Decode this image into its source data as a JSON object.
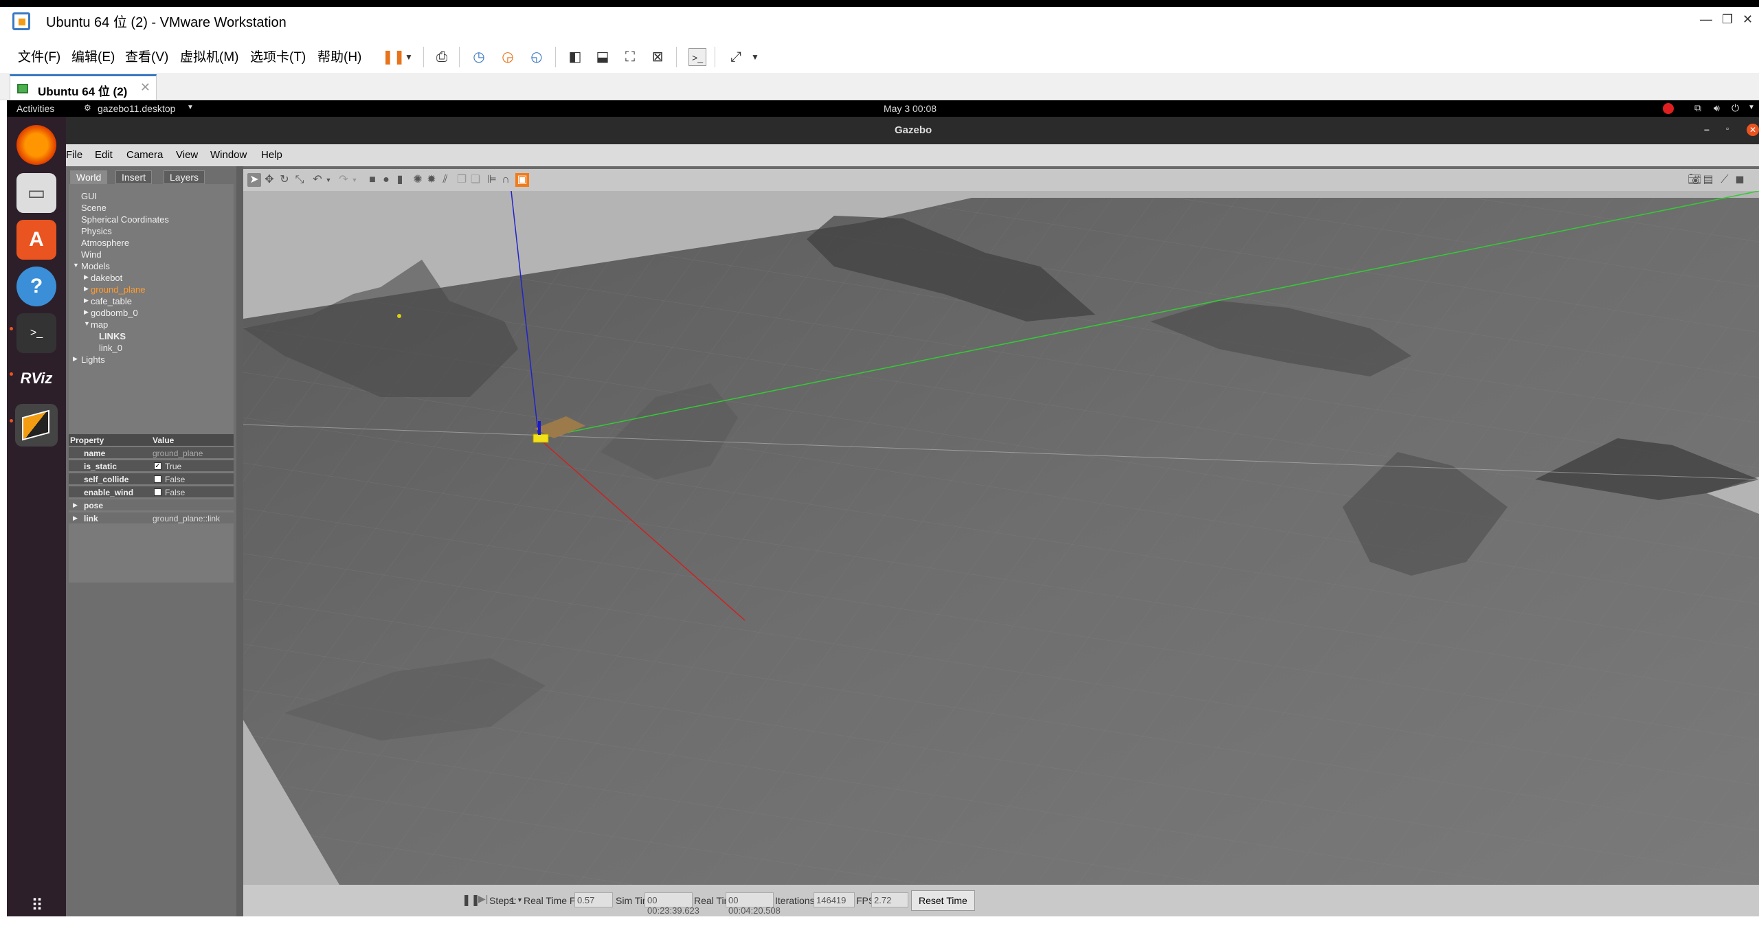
{
  "vmware": {
    "title": "Ubuntu 64 位 (2) - VMware Workstation",
    "menu": [
      "文件(F)",
      "编辑(E)",
      "查看(V)",
      "虚拟机(M)",
      "选项卡(T)",
      "帮助(H)"
    ],
    "tab_label": "Ubuntu 64 位 (2)"
  },
  "ubuntu": {
    "activities": "Activities",
    "app_menu": "gazebo11.desktop",
    "clock": "May 3  00:08",
    "dock": [
      "firefox-icon",
      "files-icon",
      "app-store-icon",
      "help-icon",
      "terminal-icon",
      "rviz-icon",
      "gazebo-icon"
    ],
    "rviz_label": "RViz"
  },
  "gazebo": {
    "window_title": "Gazebo",
    "menu": [
      "File",
      "Edit",
      "Camera",
      "View",
      "Window",
      "Help"
    ],
    "tabs": [
      "World",
      "Insert",
      "Layers"
    ],
    "tree": {
      "top": [
        "GUI",
        "Scene",
        "Spherical Coordinates",
        "Physics",
        "Atmosphere",
        "Wind"
      ],
      "models_label": "Models",
      "models": [
        "dakebot",
        "ground_plane",
        "cafe_table",
        "godbomb_0",
        "map"
      ],
      "selected_model": "ground_plane",
      "map_children": [
        "LINKS",
        "link_0"
      ],
      "lights_label": "Lights"
    },
    "properties": {
      "header_property": "Property",
      "header_value": "Value",
      "rows": [
        {
          "key": "name",
          "value": "ground_plane"
        },
        {
          "key": "is_static",
          "value": "True"
        },
        {
          "key": "self_collide",
          "value": "False"
        },
        {
          "key": "enable_wind",
          "value": "False"
        },
        {
          "key": "pose",
          "value": ""
        },
        {
          "key": "link",
          "value": "ground_plane::link"
        }
      ]
    },
    "bottom": {
      "steps_label": "Steps:",
      "steps_value": "1",
      "rtf_label": "Real Time Factor:",
      "rtf_value": "0.57",
      "sim_time_label": "Sim Time:",
      "sim_time_value": "00 00:23:39.623",
      "real_time_label": "Real Time:",
      "real_time_value": "00 00:04:20.508",
      "iterations_label": "Iterations:",
      "iterations_value": "146419",
      "fps_label": "FPS:",
      "fps_value": "2.72",
      "reset_label": "Reset Time"
    }
  },
  "colors": {
    "x_axis": "#cc2222",
    "y_axis": "#33cc33",
    "z_axis": "#2222cc",
    "selected": "#ff9a2e",
    "ubuntu_orange": "#e95420"
  }
}
